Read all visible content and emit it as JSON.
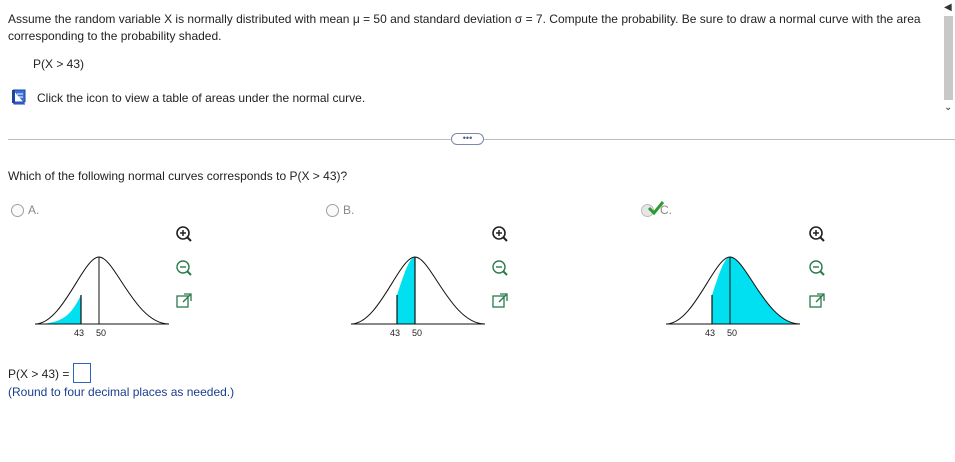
{
  "question": {
    "text": "Assume the random variable X is normally distributed with mean μ = 50 and standard deviation σ = 7. Compute the probability. Be sure to draw a normal curve with the area corresponding to the probability shaded.",
    "prob_expr": "P(X > 43)",
    "hint": "Click the icon to view a table of areas under the normal curve."
  },
  "divider": {
    "more_label": "•••"
  },
  "part": {
    "prompt": "Which of the following normal curves corresponds to P(X > 43)?",
    "options": [
      {
        "label": "A.",
        "ticks": [
          "43",
          "50"
        ],
        "shading": "left-of-43",
        "selected": false
      },
      {
        "label": "B.",
        "ticks": [
          "43",
          "50"
        ],
        "shading": "between-43-50",
        "selected": false
      },
      {
        "label": "C.",
        "ticks": [
          "43",
          "50"
        ],
        "shading": "right-of-43",
        "selected": true
      }
    ],
    "shade_color": "#00e0f0",
    "check_color": "#2e9b2e",
    "tools": [
      "zoom-in-icon",
      "zoom-out-icon",
      "popout-icon"
    ]
  },
  "answer": {
    "label": "P(X > 43) =",
    "value": "",
    "note": "(Round to four decimal places as needed.)"
  }
}
